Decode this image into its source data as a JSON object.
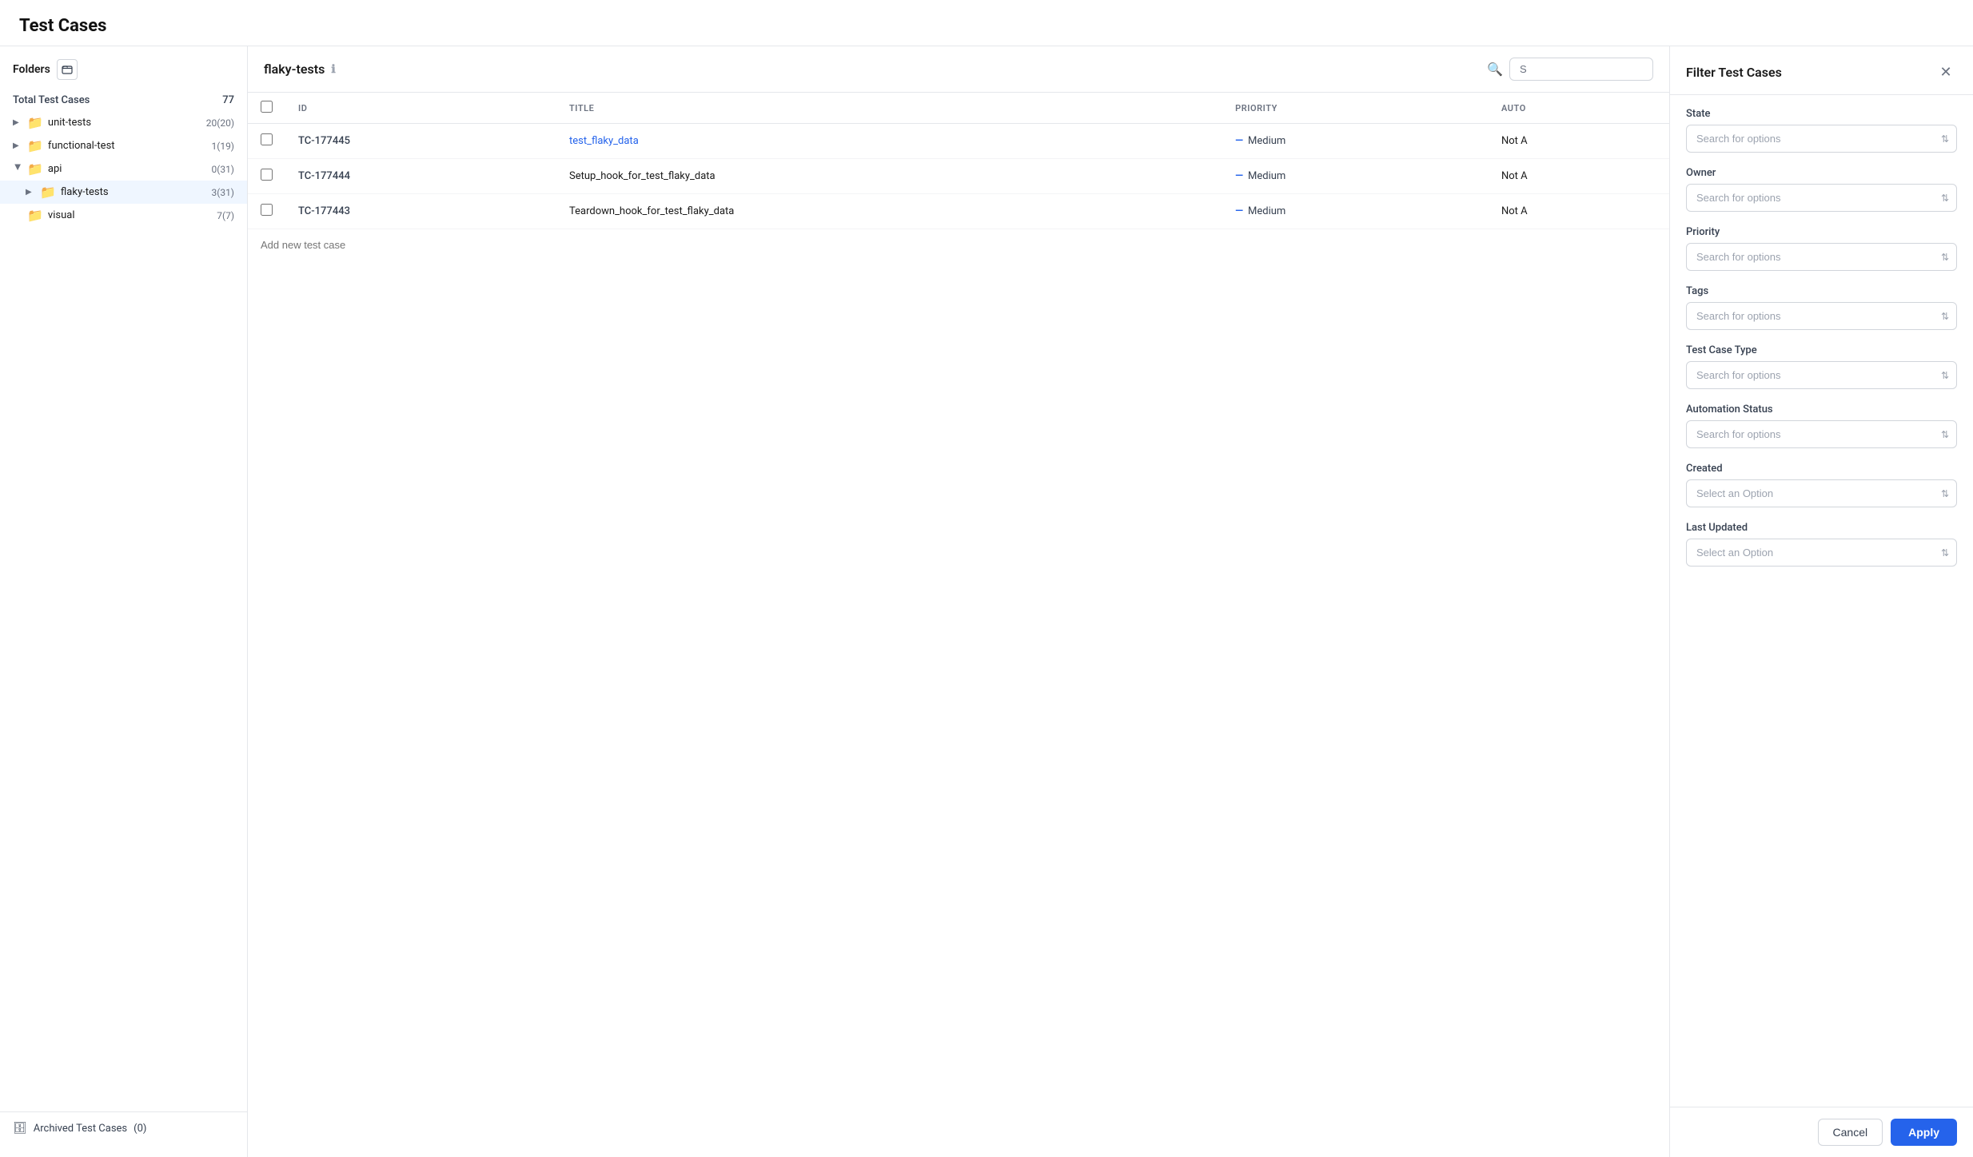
{
  "page": {
    "title": "Test Cases"
  },
  "sidebar": {
    "folders_label": "Folders",
    "total_label": "Total Test Cases",
    "total_count": "77",
    "items": [
      {
        "id": "unit-tests",
        "label": "unit-tests",
        "count": "20(20)",
        "indent": 0,
        "expanded": false,
        "active": false
      },
      {
        "id": "functional-test",
        "label": "functional-test",
        "count": "1(19)",
        "indent": 0,
        "expanded": false,
        "active": false
      },
      {
        "id": "api",
        "label": "api",
        "count": "0(31)",
        "indent": 0,
        "expanded": true,
        "active": false
      },
      {
        "id": "flaky-tests",
        "label": "flaky-tests",
        "count": "3(31)",
        "indent": 1,
        "expanded": false,
        "active": true
      },
      {
        "id": "visual",
        "label": "visual",
        "count": "7(7)",
        "indent": 0,
        "expanded": false,
        "active": false
      }
    ],
    "archived_label": "Archived Test Cases",
    "archived_count": "(0)"
  },
  "main": {
    "folder_title": "flaky-tests",
    "search_placeholder": "S",
    "columns": {
      "id": "ID",
      "title": "TITLE",
      "priority": "PRIORITY",
      "auto": "AUTO"
    },
    "rows": [
      {
        "id": "TC-177445",
        "title": "test_flaky_data",
        "is_link": true,
        "priority": "Medium"
      },
      {
        "id": "TC-177444",
        "title": "Setup_hook_for_test_flaky_data",
        "is_link": false,
        "priority": "Medium"
      },
      {
        "id": "TC-177443",
        "title": "Teardown_hook_for_test_flaky_data",
        "is_link": false,
        "priority": "Medium"
      }
    ],
    "add_placeholder": "Add new test case"
  },
  "filter": {
    "title": "Filter Test Cases",
    "fields": [
      {
        "id": "state",
        "label": "State",
        "placeholder": "Search for options",
        "type": "search"
      },
      {
        "id": "owner",
        "label": "Owner",
        "placeholder": "Search for options",
        "type": "search"
      },
      {
        "id": "priority",
        "label": "Priority",
        "placeholder": "Search for options",
        "type": "search"
      },
      {
        "id": "tags",
        "label": "Tags",
        "placeholder": "Search for options",
        "type": "search"
      },
      {
        "id": "test-case-type",
        "label": "Test Case Type",
        "placeholder": "Search for options",
        "type": "search"
      },
      {
        "id": "automation-status",
        "label": "Automation Status",
        "placeholder": "Search for options",
        "type": "search"
      },
      {
        "id": "created",
        "label": "Created",
        "placeholder": "Select an Option",
        "type": "select"
      },
      {
        "id": "last-updated",
        "label": "Last Updated",
        "placeholder": "Select an Option",
        "type": "select"
      }
    ],
    "cancel_label": "Cancel",
    "apply_label": "Apply"
  }
}
